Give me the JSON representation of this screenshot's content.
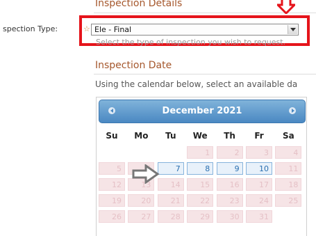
{
  "form": {
    "details_heading": "Inspection Details",
    "field_label": "spection Type:",
    "required_marker": "☆",
    "selected_type": "Ele - Final",
    "help_text": "Select the type of inspection you wish to request.",
    "date_heading": "Inspection Date",
    "intro_text": "Using the calendar below, select an available da"
  },
  "calendar": {
    "month_title": "December 2021",
    "prev_icon": "circle-chevron-left-icon",
    "next_icon": "circle-chevron-right-icon",
    "weekdays": [
      "Su",
      "Mo",
      "Tu",
      "We",
      "Th",
      "Fr",
      "Sa"
    ],
    "weeks": [
      [
        "",
        "",
        "",
        "1",
        "2",
        "3",
        "4"
      ],
      [
        "5",
        "6",
        "7",
        "8",
        "9",
        "10",
        "11"
      ],
      [
        "12",
        "13",
        "14",
        "15",
        "16",
        "17",
        "18"
      ],
      [
        "19",
        "20",
        "21",
        "22",
        "23",
        "24",
        "25"
      ],
      [
        "26",
        "27",
        "28",
        "29",
        "30",
        "31",
        ""
      ]
    ],
    "available_days": [
      "7",
      "8",
      "9",
      "10"
    ]
  },
  "annotations": {
    "highlight_color": "#e5141b",
    "arrow_color": "#777777"
  }
}
